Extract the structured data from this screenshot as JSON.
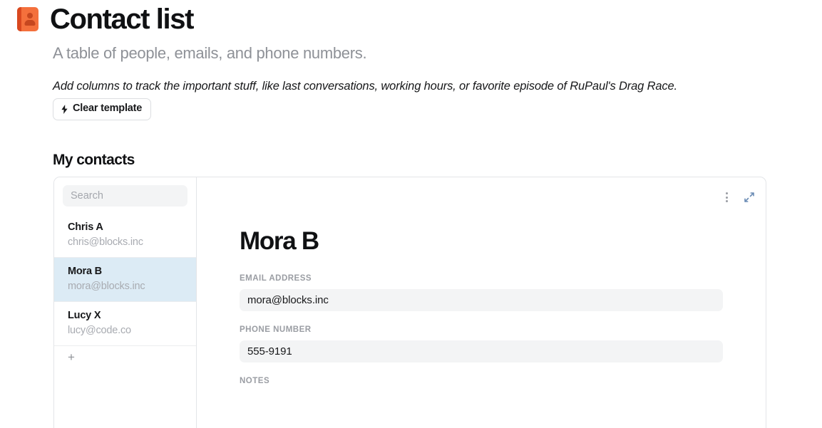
{
  "header": {
    "icon": "contact-book-icon",
    "title": "Contact list",
    "subtitle": "A table of people, emails, and phone numbers.",
    "hint": "Add columns to track the important stuff, like last conversations, working hours, or favorite episode of RuPaul's Drag Race.",
    "clear_template_label": "Clear template",
    "clear_template_icon": "lightning-bolt-icon"
  },
  "section": {
    "title": "My contacts"
  },
  "sidebar": {
    "search": {
      "placeholder": "Search",
      "value": ""
    },
    "contacts": [
      {
        "name": "Chris A",
        "email": "chris@blocks.inc",
        "selected": false
      },
      {
        "name": "Mora B",
        "email": "mora@blocks.inc",
        "selected": true
      },
      {
        "name": "Lucy X",
        "email": "lucy@code.co",
        "selected": false
      }
    ],
    "add_label": "+"
  },
  "detail": {
    "toolbar": {
      "menu_icon": "kebab-menu-icon",
      "expand_icon": "expand-diagonal-icon"
    },
    "title": "Mora B",
    "fields": [
      {
        "label": "EMAIL ADDRESS",
        "value": "mora@blocks.inc"
      },
      {
        "label": "PHONE NUMBER",
        "value": "555-9191"
      }
    ],
    "notes_label": "NOTES"
  },
  "colors": {
    "accent": "#f4703c",
    "accent_dark": "#d9481f",
    "selected_row": "#dcebf5",
    "field_bg": "#f3f4f5",
    "muted_text": "#9a9da3",
    "border": "#e3e5e8"
  }
}
